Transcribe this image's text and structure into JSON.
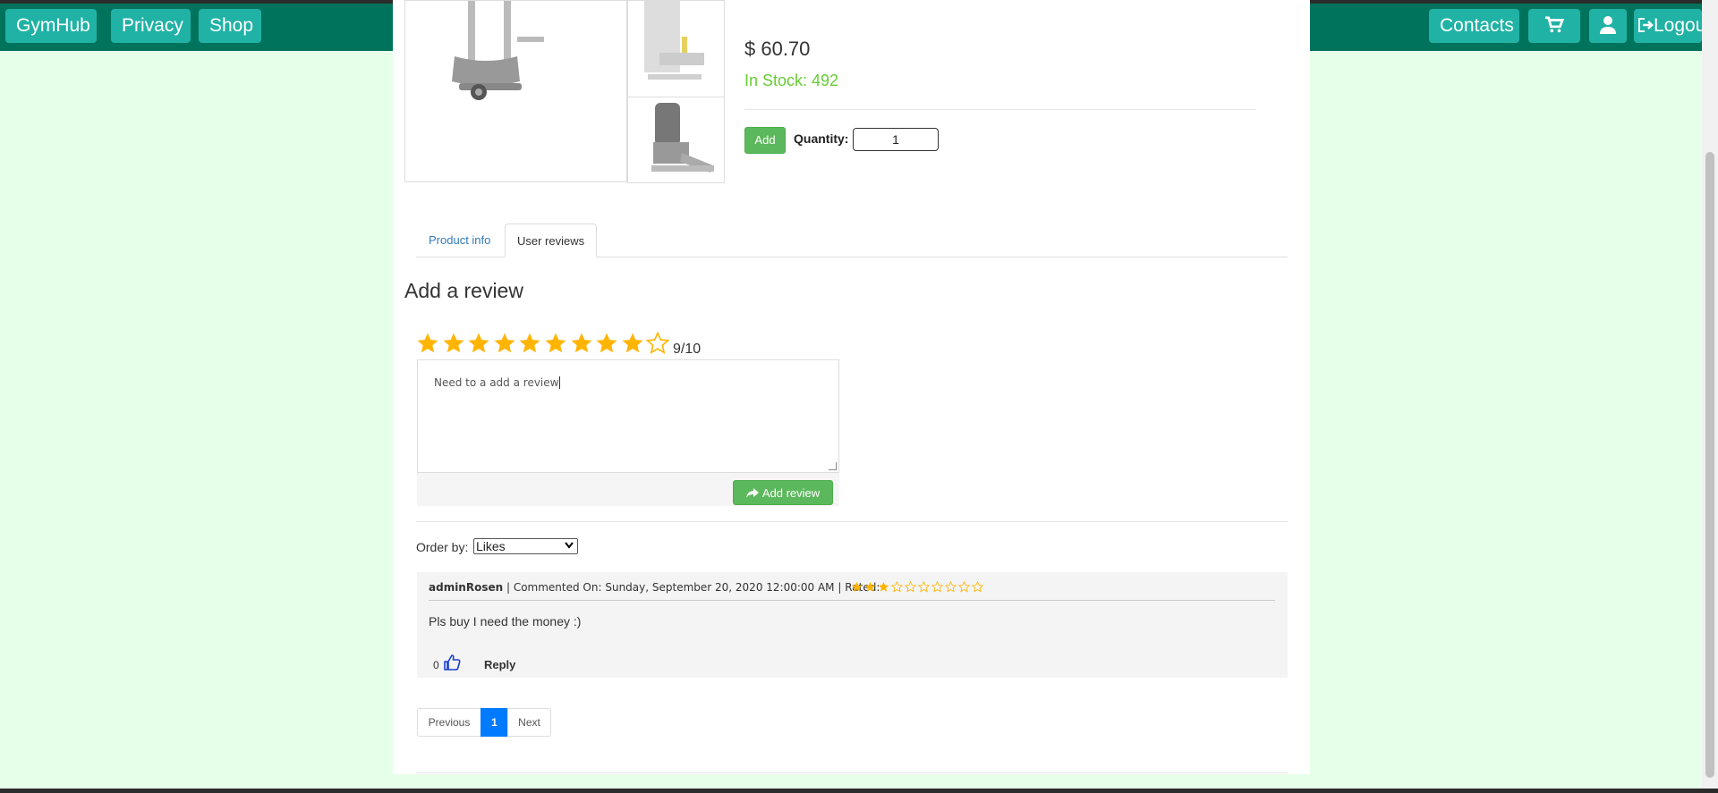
{
  "nav": {
    "brand": "GymHub",
    "privacy": "Privacy",
    "shop": "Shop",
    "contacts": "Contacts",
    "cart_icon": "cart-icon",
    "user_icon": "user-icon",
    "logout_icon": "logout-icon",
    "logout": "Logout"
  },
  "product": {
    "price": "$ 60.70",
    "stock": "In Stock: 492",
    "add_label": "Add",
    "quantity_label": "Quantity:",
    "quantity_value": "1"
  },
  "tabs": [
    {
      "label": "Product info",
      "active": false
    },
    {
      "label": "User reviews",
      "active": true
    }
  ],
  "review_form": {
    "heading": "Add a review",
    "rating_filled": 9,
    "rating_total": 10,
    "rating_text": "9/10",
    "text": "Need to a add a review",
    "submit_label": "Add review",
    "submit_icon": "share-icon"
  },
  "order": {
    "label": "Order by:",
    "selected": "Likes"
  },
  "comment": {
    "author": "adminRosen",
    "meta": " | Commented On: Sunday, September 20, 2020 12:00:00 AM | Rated: ",
    "rating_filled": 3,
    "rating_total": 10,
    "text": "Pls buy I need the money :)",
    "likes": "0",
    "like_icon": "thumbs-up-icon",
    "reply_label": "Reply"
  },
  "pagination": {
    "previous": "Previous",
    "current": "1",
    "next": "Next"
  },
  "colors": {
    "navbar": "#00735c",
    "nav_button": "#20b2a5",
    "background": "#e6ffe8",
    "star": "#ffb400",
    "success": "#5cb85c",
    "stock": "#66cc33",
    "page_active": "#007bff"
  }
}
